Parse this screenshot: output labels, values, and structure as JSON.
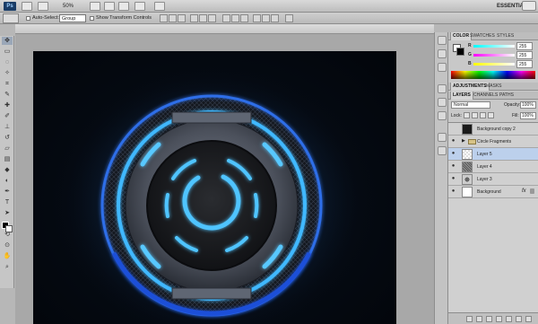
{
  "appbar": {
    "logo": "Ps",
    "zoom": "50%",
    "workspace": "ESSENTIALS"
  },
  "options": {
    "auto_select_label": "Auto-Select:",
    "auto_select_value": "Group",
    "show_transform_label": "Show Transform Controls"
  },
  "toolbox": {
    "tools": [
      "move-icon",
      "marquee-icon",
      "lasso-icon",
      "magic-wand-icon",
      "crop-icon",
      "eyedropper-icon",
      "healing-icon",
      "brush-icon",
      "stamp-icon",
      "history-brush-icon",
      "eraser-icon",
      "gradient-icon",
      "blur-icon",
      "dodge-icon",
      "pen-icon",
      "type-icon",
      "path-select-icon",
      "shape-icon",
      "3d-rotate-icon",
      "3d-orbit-icon",
      "hand-icon",
      "zoom-icon"
    ]
  },
  "color_panel": {
    "tabs": [
      "COLOR",
      "SWATCHES",
      "STYLES"
    ],
    "channels": [
      {
        "name": "R",
        "value": "255"
      },
      {
        "name": "G",
        "value": "255"
      },
      {
        "name": "B",
        "value": "255"
      }
    ]
  },
  "adjustments_panel": {
    "tabs": [
      "ADJUSTMENTS",
      "MASKS"
    ]
  },
  "layers_panel": {
    "tabs": [
      "LAYERS",
      "CHANNELS",
      "PATHS"
    ],
    "blend_mode": "Normal",
    "opacity_label": "Opacity:",
    "opacity_value": "100%",
    "lock_label": "Lock:",
    "fill_label": "Fill:",
    "fill_value": "100%",
    "layers": [
      {
        "name": "Background copy 2",
        "visible": false,
        "selected": false
      },
      {
        "name": "Circle Fragments",
        "visible": true,
        "selected": false,
        "group": true
      },
      {
        "name": "Layer 5",
        "visible": true,
        "selected": true
      },
      {
        "name": "Layer 4",
        "visible": true,
        "selected": false
      },
      {
        "name": "Layer 3",
        "visible": true,
        "selected": false
      },
      {
        "name": "Background",
        "visible": true,
        "selected": false,
        "fx": "fx"
      }
    ]
  },
  "colors": {
    "accent_glow": "#3fb8ff",
    "deep_blue": "#1d4fd8",
    "canvas_bg": "#03070d"
  }
}
